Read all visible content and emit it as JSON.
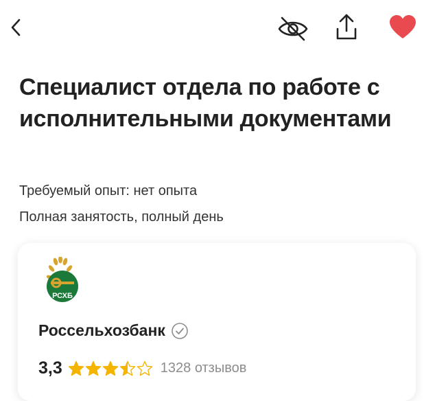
{
  "header": {
    "back_icon": "chevron-left-icon",
    "hide_icon": "eye-off-icon",
    "share_icon": "share-icon",
    "favorite_icon": "heart-icon",
    "favorite_color": "#e84a4f"
  },
  "vacancy": {
    "title": "Специалист отдела по работе с исполнительными документами",
    "experience": "Требуемый опыт: нет опыта",
    "employment": "Полная занятость, полный день"
  },
  "company": {
    "name": "Россельхозбанк",
    "logo_text": "РСХБ",
    "verified_icon": "verified-check-icon",
    "rating_value": "3,3",
    "rating_stars": 3.5,
    "rating_max": 5,
    "reviews": "1328 отзывов",
    "star_color": "#f5b400",
    "brand_color": "#1b7a3a"
  }
}
